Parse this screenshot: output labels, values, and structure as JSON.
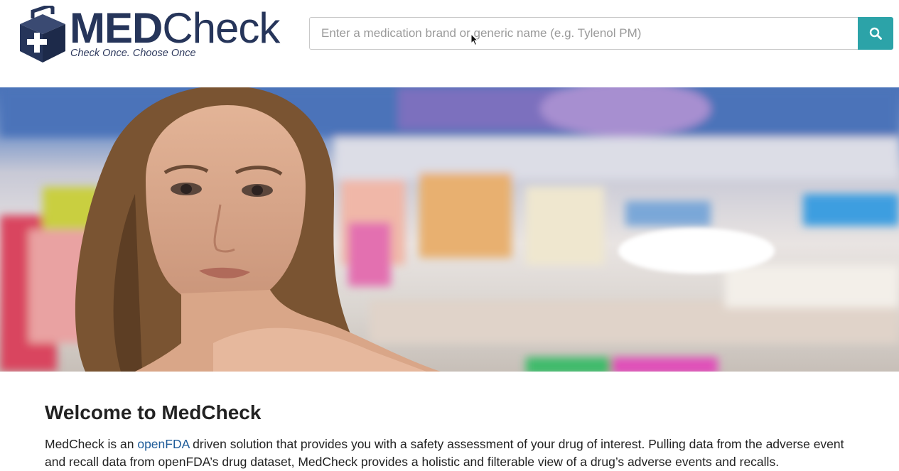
{
  "header": {
    "logo": {
      "brand_bold": "MED",
      "brand_regular": "Check",
      "tagline": "Check Once. Choose Once"
    },
    "search": {
      "placeholder": "Enter a medication brand or generic name (e.g. Tylenol PM)",
      "value": "",
      "button_icon": "search-icon"
    }
  },
  "hero": {
    "image": "woman-in-pharmacy-photo"
  },
  "main": {
    "title": "Welcome to MedCheck",
    "intro": {
      "prefix": "MedCheck is an ",
      "link_text": "openFDA",
      "suffix": " driven solution that provides you with a safety assessment of your drug of interest. Pulling data from the adverse event and recall data from openFDA’s drug dataset, MedCheck provides a holistic and filterable view of a drug’s adverse events and recalls."
    }
  },
  "colors": {
    "brand_navy": "#26355a",
    "accent_teal": "#2ca3a8",
    "link_blue": "#1f5c99"
  }
}
